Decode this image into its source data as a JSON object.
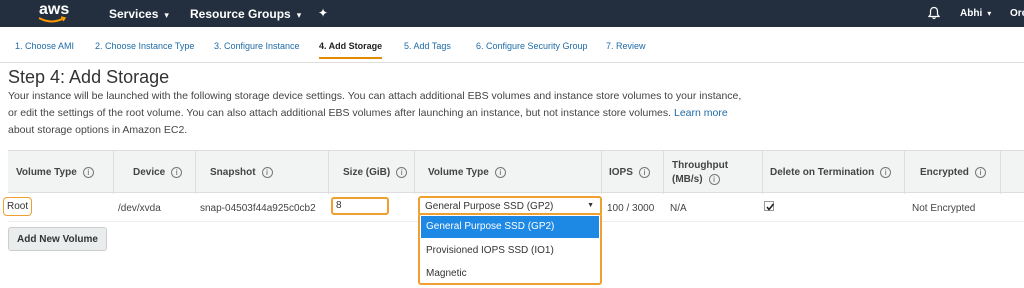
{
  "nav": {
    "logo_text": "aws",
    "services": "Services",
    "resource_groups": "Resource Groups",
    "user": "Abhi",
    "region": "Ore"
  },
  "steps": [
    {
      "label": "1. Choose AMI"
    },
    {
      "label": "2. Choose Instance Type"
    },
    {
      "label": "3. Configure Instance"
    },
    {
      "label": "4. Add Storage",
      "active": true
    },
    {
      "label": "5. Add Tags"
    },
    {
      "label": "6. Configure Security Group"
    },
    {
      "label": "7. Review"
    }
  ],
  "page": {
    "title": "Step 4: Add Storage",
    "desc_1": "Your instance will be launched with the following storage device settings. You can attach additional EBS volumes and instance store volumes to your instance, or edit the settings of the root volume. You can also attach additional EBS volumes after launching an instance, but not instance store volumes. ",
    "learn_more": "Learn more",
    "desc_2": " about storage options in Amazon EC2."
  },
  "table": {
    "headers": {
      "volume_type": "Volume Type",
      "device": "Device",
      "snapshot": "Snapshot",
      "size": "Size (GiB)",
      "volume_type_2": "Volume Type",
      "iops": "IOPS",
      "throughput_1": "Throughput",
      "throughput_2": "(MB/s)",
      "delete_on_termination": "Delete on Termination",
      "encrypted": "Encrypted"
    },
    "info_glyph": "i",
    "row": {
      "volume_type": "Root",
      "device": "/dev/xvda",
      "snapshot": "snap-04503f44a925c0cb2",
      "size": "8",
      "volume_type_select": "General Purpose SSD (GP2)",
      "iops": "100 / 3000",
      "throughput": "N/A",
      "delete_on_termination": true,
      "encrypted": "Not Encrypted"
    }
  },
  "dropdown": {
    "options": [
      {
        "label": "General Purpose SSD (GP2)",
        "selected": true
      },
      {
        "label": "Provisioned IOPS SSD (IO1)"
      },
      {
        "label": "Magnetic"
      }
    ]
  },
  "buttons": {
    "add_new_volume": "Add New Volume"
  },
  "colors": {
    "nav_bg": "#232f3e",
    "link": "#1e6ba8",
    "highlight": "#f0a030",
    "selected_option": "#1e88e5",
    "aws_smile": "#ff9900"
  }
}
